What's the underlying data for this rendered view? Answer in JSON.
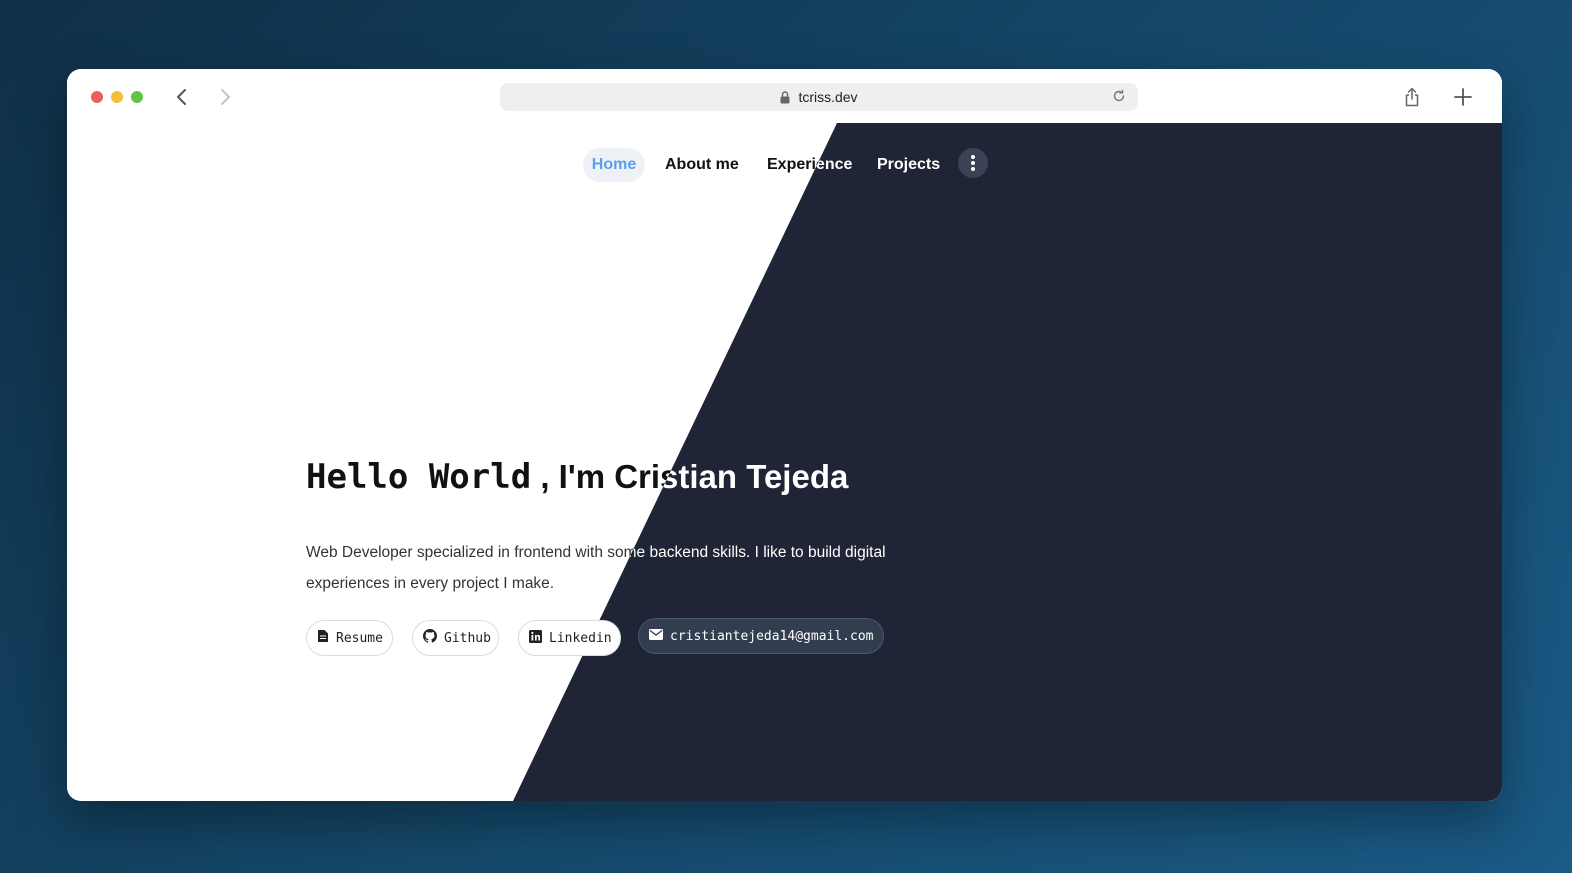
{
  "browser": {
    "url": "tcriss.dev",
    "icons": {
      "back": "chevron-left-icon",
      "forward": "chevron-right-icon",
      "lock": "lock-icon",
      "reload": "reload-icon",
      "share": "share-icon",
      "new_tab": "plus-icon"
    }
  },
  "nav": {
    "items": [
      {
        "label": "Home",
        "active": true
      },
      {
        "label": "About me"
      },
      {
        "label": "Experience"
      },
      {
        "label": "Projects"
      }
    ],
    "more_icon": "more-vertical-icon",
    "active_color": "#5b9fe8"
  },
  "hero": {
    "greeting": "Hello World",
    "intro": ", I'm Cristian Tejeda",
    "description": "Web Developer specialized in frontend with some backend skills. I like to build digital experiences in every project I make."
  },
  "links": {
    "resume": {
      "label": "Resume",
      "icon": "document-icon"
    },
    "github": {
      "label": "Github",
      "icon": "github-icon"
    },
    "linkedin": {
      "label": "Linkedin",
      "icon": "linkedin-icon"
    },
    "email": {
      "label": "cristiantejeda14@gmail.com",
      "icon": "mail-icon"
    }
  },
  "theme": {
    "dark_bg": "#1f2536",
    "light_bg": "#ffffff"
  }
}
